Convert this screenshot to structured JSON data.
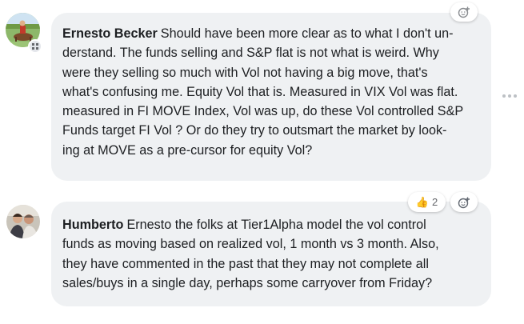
{
  "comments": [
    {
      "author": "Ernesto Becker",
      "lines": [
        "Should have been more clear as to what I don't un-",
        "derstand. The funds selling and S&P flat is not what is weird. Why",
        "were they selling so much with Vol not having a big move, that's",
        "what's confusing me. Equity Vol that is. Measured in VIX Vol was flat.",
        "measured in FI MOVE Index, Vol was up, do these Vol controlled S&P",
        "Funds target FI Vol ? Or do they try to outsmart the market by look-",
        "ing at MOVE as a pre-cursor for equity Vol?"
      ],
      "avatar_icon": "avatar-horse-rider",
      "badge_icon": "badge-icon"
    },
    {
      "author": "Humberto",
      "lines": [
        "Ernesto the folks at Tier1Alpha model the vol control",
        "funds as moving based on realized vol, 1 month vs 3 month. Also,",
        "they have commented in the past that they may not complete all",
        "sales/buys in a single day, perhaps some carryover from Friday?"
      ],
      "avatar_icon": "avatar-couple-photo",
      "reactions": {
        "emoji": "👍",
        "count": "2"
      }
    }
  ],
  "icons": {
    "add_reaction": "add-reaction-icon",
    "more_options": "more-options-icon"
  },
  "colors": {
    "bubble_bg": "#eff1f3",
    "text": "#1c1e21",
    "secondary": "#65676b"
  }
}
